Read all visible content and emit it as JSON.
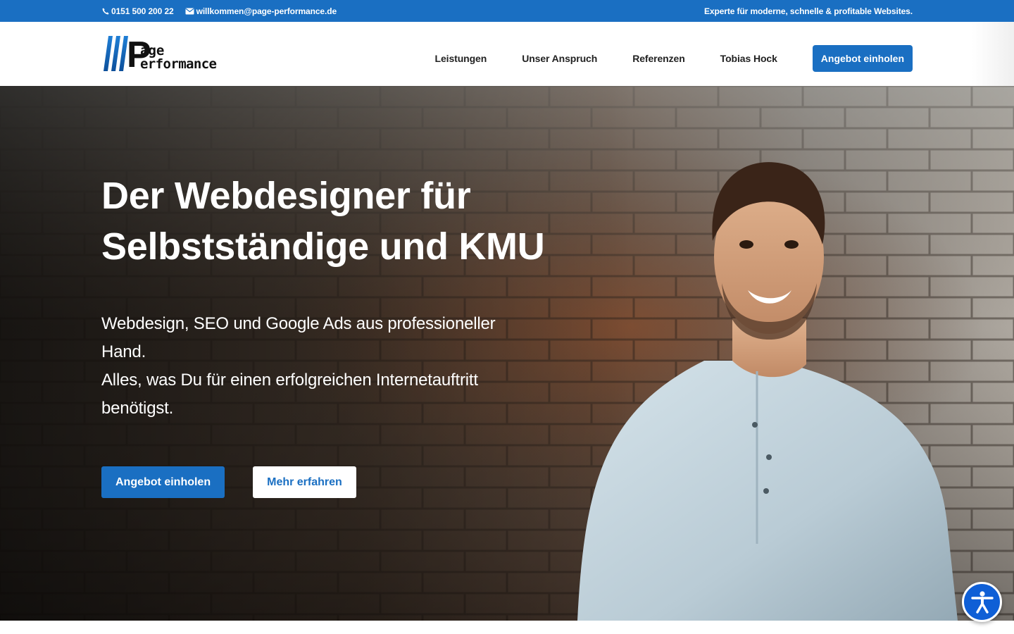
{
  "topbar": {
    "phone": "0151 500 200 22",
    "email": "willkommen@page-performance.de",
    "tagline": "Experte für moderne, schnelle & profitable Websites."
  },
  "logo": {
    "text_big_letter": "P",
    "text_page": "age",
    "text_performance": "erformance"
  },
  "nav": {
    "items": [
      {
        "label": "Leistungen"
      },
      {
        "label": "Unser Anspruch"
      },
      {
        "label": "Referenzen"
      },
      {
        "label": "Tobias Hock"
      }
    ],
    "cta_label": "Angebot einholen"
  },
  "hero": {
    "title_line1": "Der Webdesigner für",
    "title_line2": "Selbstständige und KMU",
    "sub_line1": "Webdesign, SEO und Google Ads aus professioneller Hand.",
    "sub_line2": "Alles, was Du für einen erfolgreichen Internetauftritt benötigst.",
    "primary_button": "Angebot einholen",
    "secondary_button": "Mehr erfahren"
  },
  "colors": {
    "brand_blue": "#1a6fc2",
    "accessibility_blue": "#0f5fd6"
  },
  "icons": {
    "phone": "phone-icon",
    "email": "mail-icon",
    "accessibility": "accessibility-icon"
  }
}
